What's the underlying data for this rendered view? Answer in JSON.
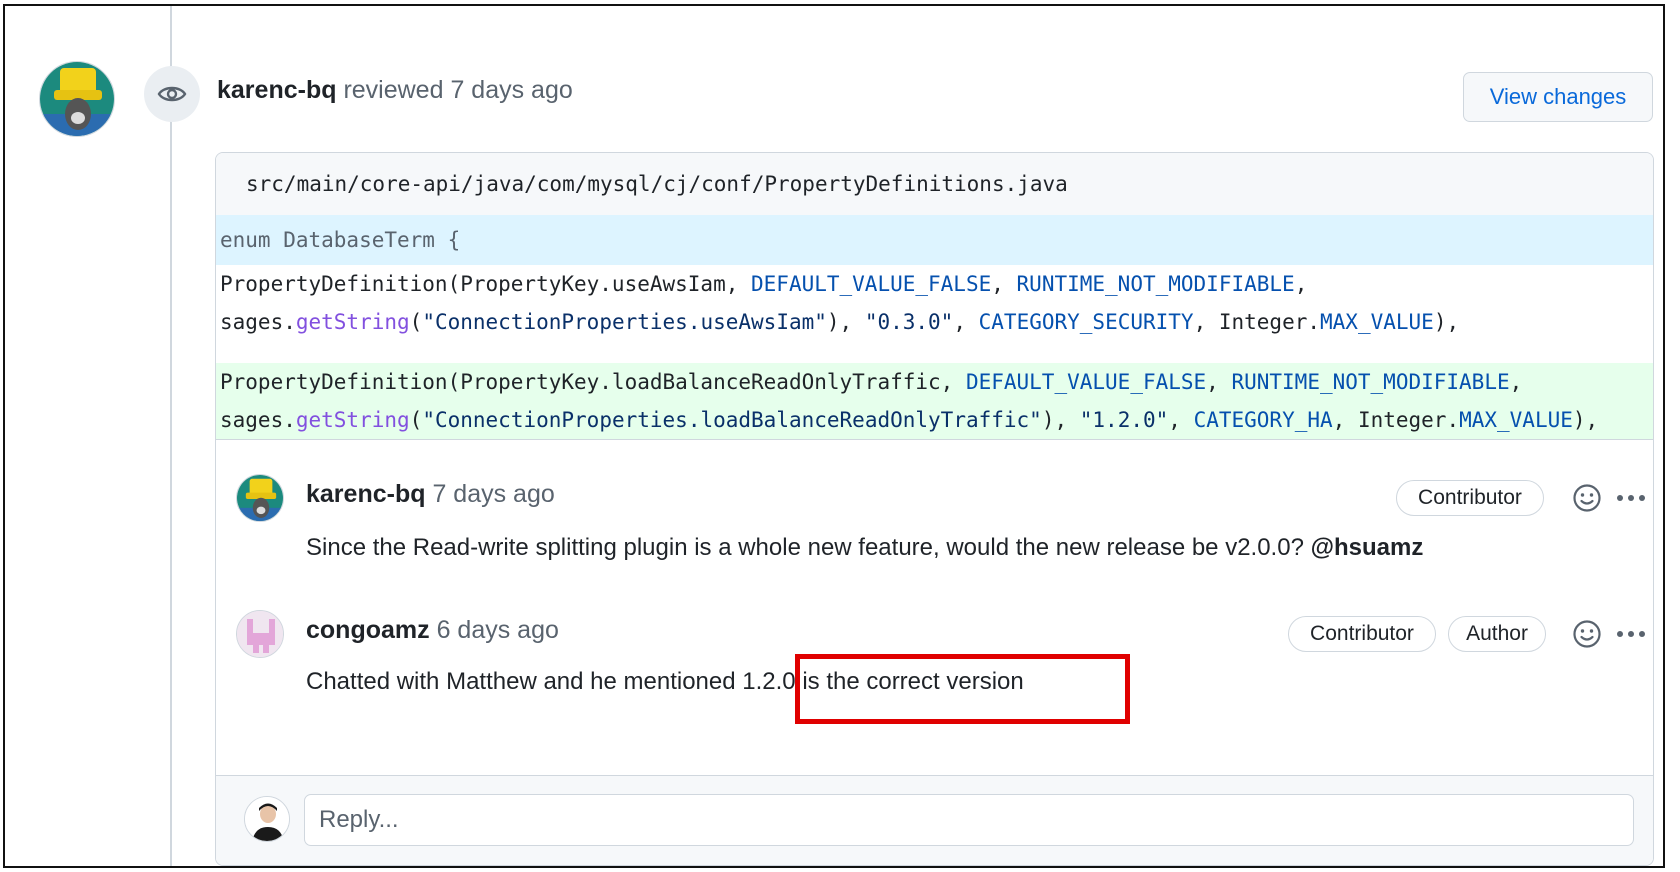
{
  "review": {
    "username": "karenc-bq",
    "action": "reviewed",
    "time": "7 days ago",
    "view_changes_label": "View changes"
  },
  "file": {
    "path": "src/main/core-api/java/com/mysql/cj/conf/PropertyDefinitions.java",
    "hunk_header": "enum DatabaseTerm {",
    "lines": [
      {
        "type": "context",
        "segments": [
          {
            "t": "PropertyDefinition(PropertyKey.useAwsIam, ",
            "k": "plain"
          },
          {
            "t": "DEFAULT_VALUE_FALSE",
            "k": "const"
          },
          {
            "t": ", ",
            "k": "plain"
          },
          {
            "t": "RUNTIME_NOT_MODIFIABLE",
            "k": "const"
          },
          {
            "t": ",",
            "k": "plain"
          }
        ]
      },
      {
        "type": "context",
        "segments": [
          {
            "t": "sages.",
            "k": "plain"
          },
          {
            "t": "getString",
            "k": "fn"
          },
          {
            "t": "(",
            "k": "plain"
          },
          {
            "t": "\"ConnectionProperties.useAwsIam\"",
            "k": "str"
          },
          {
            "t": "), ",
            "k": "plain"
          },
          {
            "t": "\"0.3.0\"",
            "k": "str"
          },
          {
            "t": ", ",
            "k": "plain"
          },
          {
            "t": "CATEGORY_SECURITY",
            "k": "const"
          },
          {
            "t": ", Integer.",
            "k": "plain"
          },
          {
            "t": "MAX_VALUE",
            "k": "const"
          },
          {
            "t": "),",
            "k": "plain"
          }
        ]
      },
      {
        "type": "blank",
        "segments": []
      },
      {
        "type": "added",
        "segments": [
          {
            "t": "PropertyDefinition(PropertyKey.loadBalanceReadOnlyTraffic, ",
            "k": "plain"
          },
          {
            "t": "DEFAULT_VALUE_FALSE",
            "k": "const"
          },
          {
            "t": ", ",
            "k": "plain"
          },
          {
            "t": "RUNTIME_NOT_MODIFIABLE",
            "k": "const"
          },
          {
            "t": ",",
            "k": "plain"
          }
        ]
      },
      {
        "type": "added",
        "segments": [
          {
            "t": "sages.",
            "k": "plain"
          },
          {
            "t": "getString",
            "k": "fn"
          },
          {
            "t": "(",
            "k": "plain"
          },
          {
            "t": "\"ConnectionProperties.loadBalanceReadOnlyTraffic\"",
            "k": "str"
          },
          {
            "t": "), ",
            "k": "plain"
          },
          {
            "t": "\"1.2.0\"",
            "k": "str"
          },
          {
            "t": ", ",
            "k": "plain"
          },
          {
            "t": "CATEGORY_HA",
            "k": "const"
          },
          {
            "t": ", Integer.",
            "k": "plain"
          },
          {
            "t": "MAX_VALUE",
            "k": "const"
          },
          {
            "t": "),",
            "k": "plain"
          }
        ]
      }
    ]
  },
  "comments": [
    {
      "username": "karenc-bq",
      "time": "7 days ago",
      "labels": [
        "Contributor"
      ],
      "body": "Since the Read-write splitting plugin is a whole new feature, would the new release be v2.0.0? ",
      "mention": "@hsuamz"
    },
    {
      "username": "congoamz",
      "time": "6 days ago",
      "labels": [
        "Contributor",
        "Author"
      ],
      "body_prefix": "Chatted with Matthew and he mentioned ",
      "body_highlight": "1.2.0 is the correct version"
    }
  ],
  "reply": {
    "placeholder": "Reply..."
  },
  "colors": {
    "accent": "#0969da",
    "added_bg": "#e6ffec",
    "hunk_bg": "#ddf4ff",
    "highlight_box": "#e00000"
  },
  "icons": {
    "review": "eye-icon",
    "reaction": "smiley-icon",
    "more": "kebab-horizontal-icon"
  }
}
